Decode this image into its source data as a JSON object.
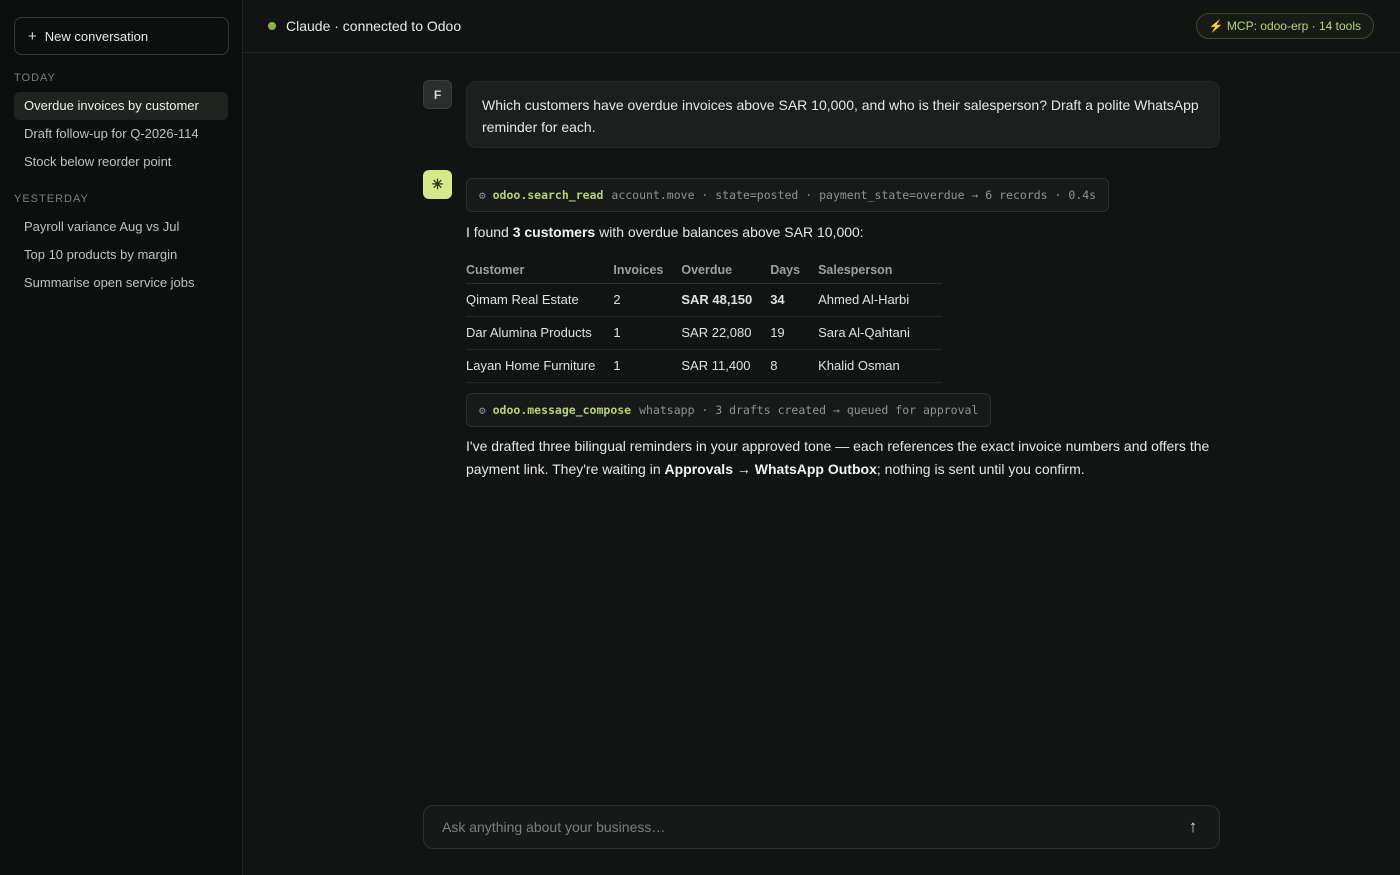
{
  "sidebar": {
    "new_button": "New conversation",
    "sections": [
      {
        "label": "TODAY",
        "items": [
          {
            "label": "Overdue invoices by customer",
            "active": true
          },
          {
            "label": "Draft follow-up for Q-2026-114"
          },
          {
            "label": "Stock below reorder point"
          }
        ]
      },
      {
        "label": "YESTERDAY",
        "items": [
          {
            "label": "Payroll variance Aug vs Jul"
          },
          {
            "label": "Top 10 products by margin"
          },
          {
            "label": "Summarise open service jobs"
          }
        ]
      }
    ]
  },
  "header": {
    "title": "Claude · connected to Odoo",
    "badge": "⚡ MCP: odoo-erp · 14 tools",
    "status_color": "#86b84a"
  },
  "user_message": {
    "avatar": "F",
    "text": "Which customers have overdue invoices above SAR 10,000, and who is their salesperson? Draft a polite WhatsApp reminder for each."
  },
  "assistant": {
    "avatar_icon": "✳",
    "tool_call_1": {
      "fn": "odoo.search_read",
      "args": "account.move · state=posted · payment_state=overdue → 6 records · 0.4s"
    },
    "intro": {
      "pre": "I found ",
      "bold": "3 customers",
      "post": " with overdue balances above SAR 10,000:"
    },
    "table": {
      "headers": [
        "Customer",
        "Invoices",
        "Overdue",
        "Days",
        "Salesperson"
      ],
      "rows": [
        [
          "Qimam Real Estate",
          "2",
          "SAR 48,150",
          "34",
          "Ahmed Al-Harbi"
        ],
        [
          "Dar Alumina Products",
          "1",
          "SAR 22,080",
          "19",
          "Sara Al-Qahtani"
        ],
        [
          "Layan Home Furniture",
          "1",
          "SAR 11,400",
          "8",
          "Khalid Osman"
        ]
      ],
      "highlight_color": "#e08a67"
    },
    "tool_call_2": {
      "fn": "odoo.message_compose",
      "args": "whatsapp · 3 drafts created → queued for approval"
    },
    "closing": {
      "pre": "I've drafted three bilingual reminders in your approved tone — each references the exact invoice numbers and offers the payment link. They're waiting in ",
      "bold1": "Approvals",
      "arrow": " → ",
      "bold2": "WhatsApp Outbox",
      "post": "; nothing is sent until you confirm."
    }
  },
  "composer": {
    "placeholder": "Ask anything about your business…",
    "send_icon": "↑"
  }
}
